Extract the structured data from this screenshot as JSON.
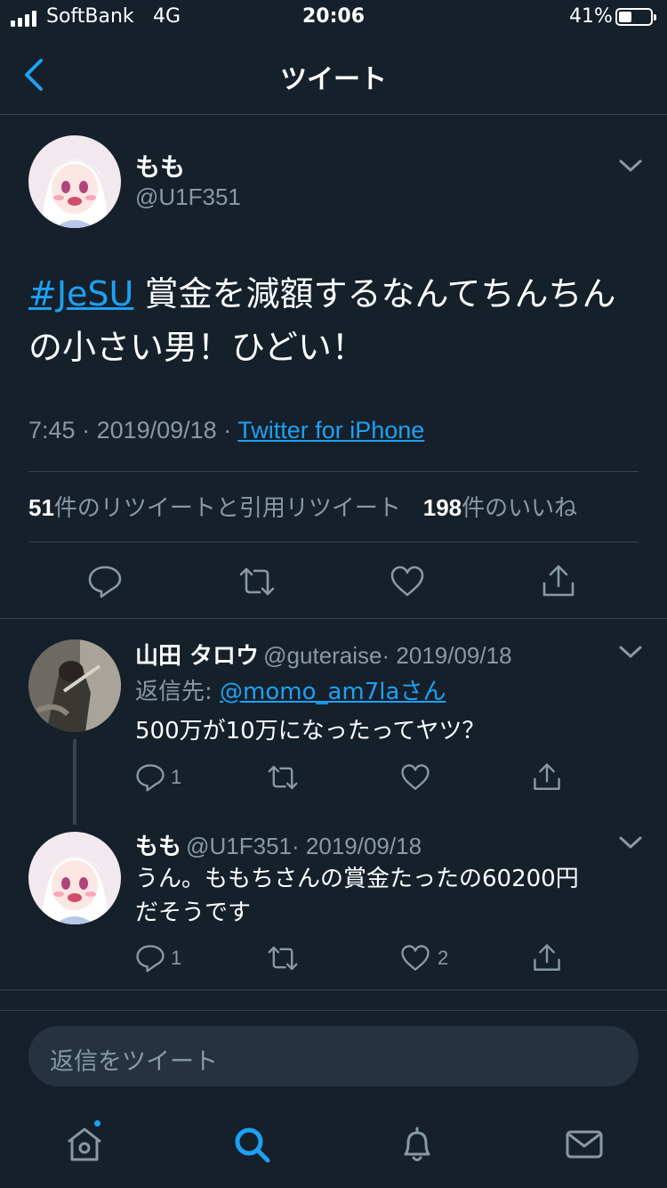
{
  "status_bar": {
    "carrier": "SoftBank",
    "network": "4G",
    "time": "20:06",
    "battery": "41%",
    "battery_level": 0.41
  },
  "header": {
    "title": "ツイート"
  },
  "main_tweet": {
    "display_name": "もも",
    "handle": "@U1F351",
    "hashtag": "#JeSU",
    "text": " 賞金を減額するなんてちんちんの小さい男！ひどい！",
    "time": "7:45",
    "date": "2019/09/18",
    "separator": " · ",
    "source": "Twitter for iPhone",
    "retweet_count": "51",
    "retweet_label": "件のリツイートと引用リツイート",
    "like_count": "198",
    "like_label": "件のいいね"
  },
  "replies": [
    {
      "display_name": "山田 タロウ",
      "handle": "@guteraise",
      "date": "· 2019/09/18",
      "reply_to_label": "返信先: ",
      "reply_to_mention": "@momo_am7laさん",
      "text": "500万が10万になったってヤツ？",
      "reply_count": "1",
      "retweet_count": "",
      "like_count": ""
    },
    {
      "display_name": "もも",
      "handle": "@U1F351",
      "date": "· 2019/09/18",
      "text_line1": "うん。ももちさんの賞金たったの60200円",
      "text_line2": "だそうです",
      "reply_count": "1",
      "retweet_count": "",
      "like_count": "2"
    }
  ],
  "composer": {
    "placeholder": "返信をツイート"
  },
  "tab_bar": {
    "items": [
      "home-icon",
      "search-icon",
      "bell-icon",
      "mail-icon"
    ],
    "active": "search-icon"
  },
  "colors": {
    "background": "#15202b",
    "accent": "#1da1f2",
    "secondary_text": "#8899a6",
    "divider": "#38444d"
  }
}
